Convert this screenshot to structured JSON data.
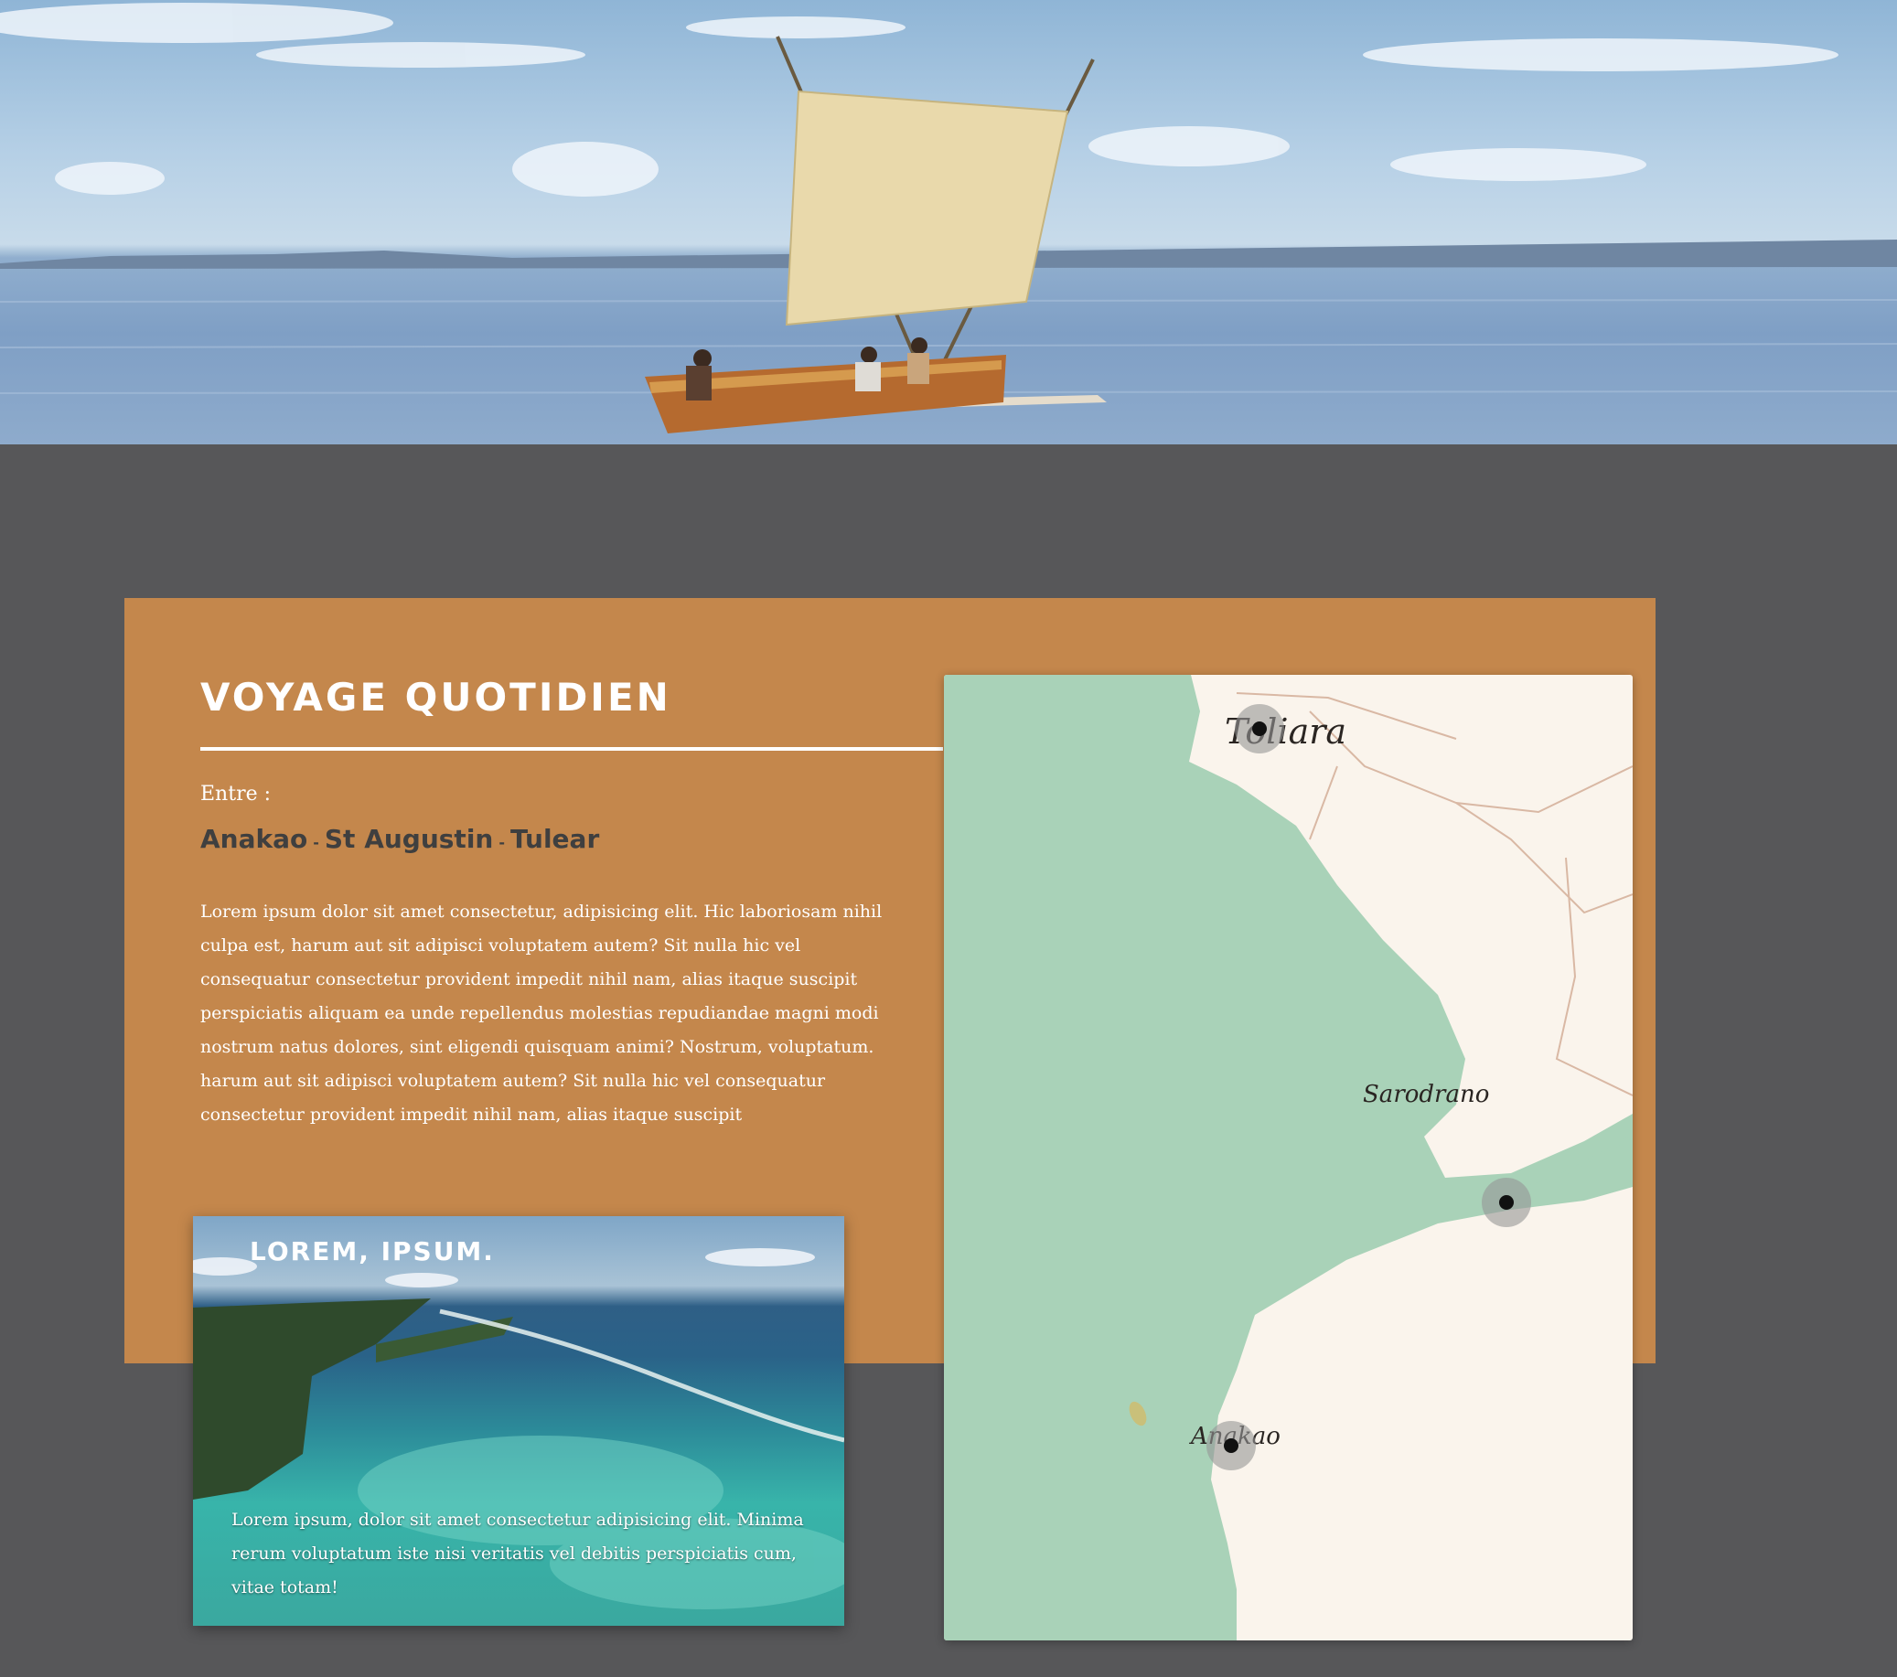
{
  "hero": {
    "image": "sailing-pirogue-photo"
  },
  "section": {
    "title": "VOYAGE QUOTIDIEN",
    "between_label": "Entre :",
    "route": {
      "stop1": "Anakao",
      "stop2": "St Augustin",
      "stop3": "Tulear",
      "separator": "-"
    },
    "paragraph": "Lorem ipsum dolor sit amet consectetur, adipisicing elit. Hic laboriosam nihil culpa est, harum aut sit adipisci voluptatem autem? Sit nulla hic vel consequatur consectetur provident impedit nihil nam, alias itaque suscipit perspiciatis aliquam ea unde repellendus molestias repudiandae magni modi nostrum natus dolores, sint eligendi quisquam animi? Nostrum, voluptatum. harum aut sit adipisci voluptatem autem? Sit nulla hic vel consequatur consectetur provident impedit nihil nam, alias itaque suscipit"
  },
  "photo_card": {
    "title": "LOREM, IPSUM.",
    "text": "Lorem ipsum, dolor sit amet consectetur adipisicing elit. Minima rerum voluptatum iste nisi veritatis vel debitis perspiciatis cum, vitae totam!"
  },
  "map": {
    "labels": {
      "toliara": "Toliara",
      "sarodrano": "Sarodrano",
      "anakao": "Anakao"
    },
    "markers": [
      "toliara-marker",
      "st-augustin-marker",
      "anakao-marker"
    ]
  },
  "colors": {
    "card": "#c4874c",
    "page_bg": "#575759",
    "sea": "#a9d2b8",
    "land": "#faf4ec"
  }
}
